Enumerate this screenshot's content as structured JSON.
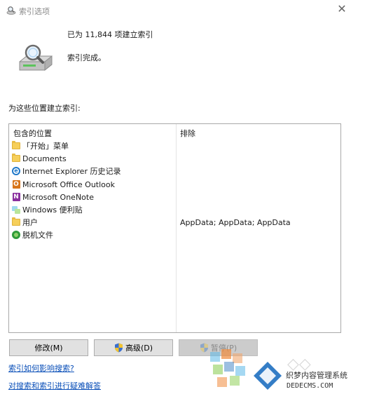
{
  "window": {
    "title": "索引选项",
    "close_glyph": "✕"
  },
  "status": {
    "indexed_count": "已为 11,844 项建立索引",
    "message": "索引完成。",
    "icon": "magnifier-drive-icon"
  },
  "locations": {
    "heading": "为这些位置建立索引:",
    "columns": {
      "included": "包含的位置",
      "excluded": "排除"
    },
    "items": [
      {
        "label": "「开始」菜单",
        "icon": "folder-icon",
        "exclude": ""
      },
      {
        "label": "Documents",
        "icon": "folder-icon",
        "exclude": ""
      },
      {
        "label": "Internet Explorer 历史记录",
        "icon": "internet-explorer-icon",
        "exclude": ""
      },
      {
        "label": "Microsoft Office Outlook",
        "icon": "outlook-icon",
        "exclude": ""
      },
      {
        "label": "Microsoft OneNote",
        "icon": "onenote-icon",
        "exclude": ""
      },
      {
        "label": "Windows 便利贴",
        "icon": "sticky-notes-icon",
        "exclude": ""
      },
      {
        "label": "用户",
        "icon": "folder-icon",
        "exclude": "AppData; AppData; AppData"
      },
      {
        "label": "脱机文件",
        "icon": "offline-files-icon",
        "exclude": ""
      }
    ]
  },
  "buttons": {
    "modify": "修改(M)",
    "advanced": "高级(D)",
    "pause": "暂停(P)"
  },
  "links": {
    "how_affects": "索引如何影响搜索?",
    "troubleshoot": "对搜索和索引进行疑难解答"
  },
  "watermark": {
    "brand": "织梦内容管理系统",
    "site": "DEDECMS.COM",
    "colors": [
      "#5bb8e8",
      "#f08a3c",
      "#8fcf5a",
      "#3a7fc4"
    ]
  }
}
